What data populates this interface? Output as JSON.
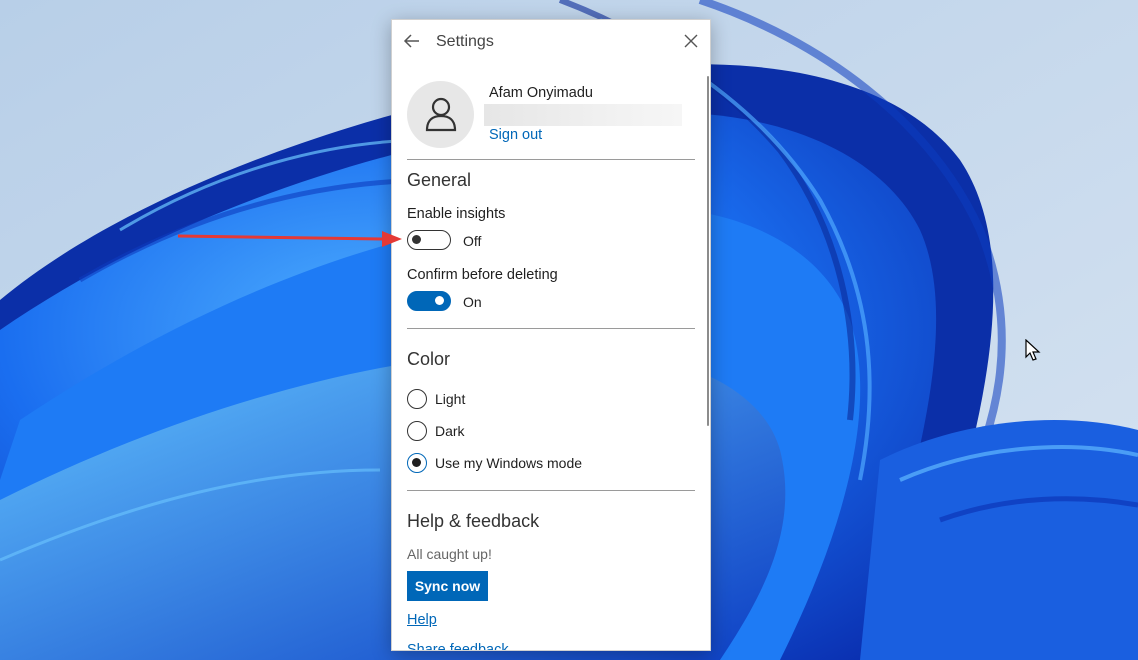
{
  "window": {
    "title": "Settings"
  },
  "account": {
    "name": "Afam Onyimadu",
    "sign_out_label": "Sign out"
  },
  "general": {
    "heading": "General",
    "enable_insights": {
      "label": "Enable insights",
      "state_text": "Off",
      "on": false
    },
    "confirm_delete": {
      "label": "Confirm before deleting",
      "state_text": "On",
      "on": true
    }
  },
  "color": {
    "heading": "Color",
    "options": [
      {
        "label": "Light",
        "selected": false
      },
      {
        "label": "Dark",
        "selected": false
      },
      {
        "label": "Use my Windows mode",
        "selected": true
      }
    ]
  },
  "help": {
    "heading": "Help & feedback",
    "status": "All caught up!",
    "sync_label": "Sync now",
    "help_link": "Help",
    "share_feedback_link": "Share feedback"
  },
  "colors": {
    "accent": "#0067b8",
    "annotation_arrow": "#e53935",
    "wallpaper_base": "#c9dcef",
    "wallpaper_bloom": "#1a5fe0"
  },
  "icons": {
    "back": "arrow-left-icon",
    "close": "close-x-icon",
    "avatar": "person-icon",
    "annotation": "red-arrow",
    "cursor": "mouse-pointer-icon"
  }
}
